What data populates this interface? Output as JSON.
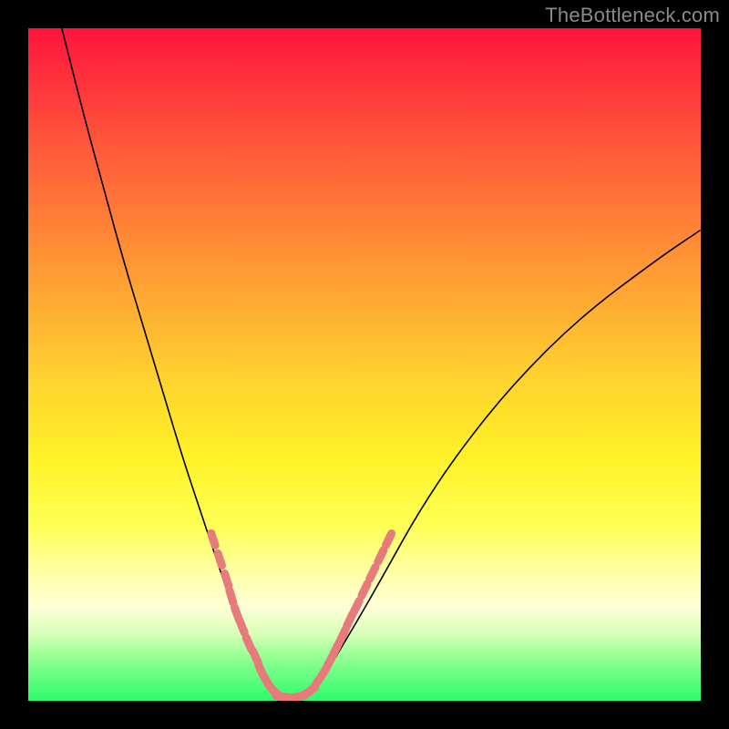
{
  "watermark": "TheBottleneck.com",
  "chart_data": {
    "type": "line",
    "title": "",
    "xlabel": "",
    "ylabel": "",
    "xlim": [
      0,
      100
    ],
    "ylim": [
      0,
      100
    ],
    "background_gradient": {
      "direction": "vertical",
      "stops": [
        {
          "pos": 0.0,
          "color": "#ff143c"
        },
        {
          "pos": 0.18,
          "color": "#ff5a3a"
        },
        {
          "pos": 0.36,
          "color": "#ff9a34"
        },
        {
          "pos": 0.52,
          "color": "#ffd22e"
        },
        {
          "pos": 0.64,
          "color": "#fff228"
        },
        {
          "pos": 0.74,
          "color": "#ffff55"
        },
        {
          "pos": 0.81,
          "color": "#ffffa8"
        },
        {
          "pos": 0.86,
          "color": "#ffffd6"
        },
        {
          "pos": 0.9,
          "color": "#d8ffb8"
        },
        {
          "pos": 0.94,
          "color": "#8cff90"
        },
        {
          "pos": 1.0,
          "color": "#2cfc6a"
        }
      ]
    },
    "series": [
      {
        "name": "bottleneck-curve",
        "stroke": "#000000",
        "stroke_width": 1.6,
        "x": [
          5,
          8,
          11,
          14,
          17,
          20,
          23,
          26,
          28,
          30,
          32,
          34,
          35.5,
          37,
          38.5,
          40,
          42,
          44,
          46,
          49,
          53,
          58,
          64,
          72,
          82,
          94,
          100
        ],
        "y": [
          100,
          88,
          77,
          66,
          56,
          46,
          36,
          27,
          21,
          15,
          10,
          6,
          3.5,
          1.5,
          0.5,
          0.5,
          1.5,
          3.5,
          7,
          12,
          19,
          28,
          37,
          47,
          57,
          66,
          70
        ]
      },
      {
        "name": "data-points-left",
        "type": "scatter",
        "marker": "circle",
        "color": "#e77a7a",
        "x": [
          27.5,
          28.5,
          29.5,
          30.2,
          31.0,
          31.8,
          32.8,
          33.8,
          34.6,
          35.4,
          36.2,
          37.0
        ],
        "y": [
          24.0,
          21.0,
          18.0,
          15.5,
          13.0,
          11.0,
          8.5,
          6.5,
          4.5,
          3.0,
          1.8,
          1.0
        ]
      },
      {
        "name": "data-points-bottom",
        "type": "scatter",
        "marker": "circle",
        "color": "#e77a7a",
        "x": [
          37.8,
          38.6,
          39.4,
          40.2,
          41.0,
          41.8
        ],
        "y": [
          0.6,
          0.5,
          0.5,
          0.6,
          0.9,
          1.4
        ]
      },
      {
        "name": "data-points-right",
        "type": "scatter",
        "marker": "circle",
        "color": "#e77a7a",
        "x": [
          42.8,
          43.8,
          44.8,
          45.8,
          46.8,
          47.8,
          48.8,
          50.0,
          51.2,
          52.4,
          53.6
        ],
        "y": [
          2.5,
          4.0,
          5.8,
          7.8,
          9.8,
          12.0,
          14.0,
          16.5,
          19.0,
          21.5,
          24.0
        ]
      }
    ]
  }
}
